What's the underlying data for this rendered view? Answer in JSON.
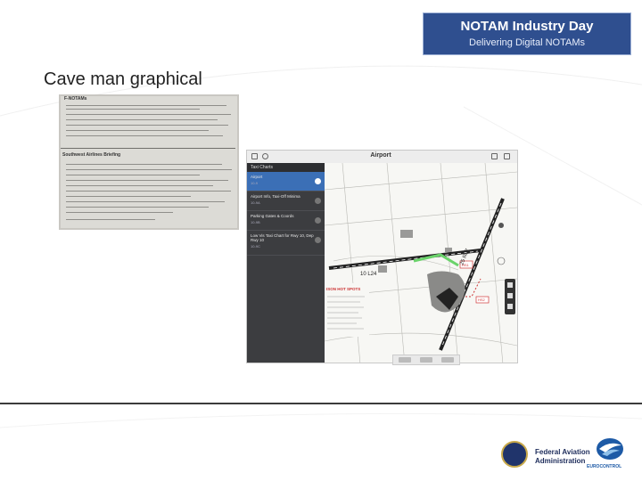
{
  "banner": {
    "line1": "NOTAM Industry Day",
    "line2": "Delivering Digital NOTAMs"
  },
  "slide": {
    "title": "Cave man graphical"
  },
  "paper_photo": {
    "header": "F-NOTAMs",
    "section": "Southwest Airlines Briefing"
  },
  "ipad": {
    "title": "Airport",
    "list_header": "Taxi Charts",
    "items": [
      {
        "label": "Airport",
        "sub": "10-9"
      },
      {
        "label": "Airport Info, Taxi-Off Minima",
        "sub": "10-9A"
      },
      {
        "label": "Parking Gates & Coords",
        "sub": "10-9B"
      },
      {
        "label": "Low Vis Taxi Chart for Rwy 10, Dep Rwy 10",
        "sub": "10-9C"
      }
    ],
    "map_labels": {
      "runway1": "10 L24",
      "runway2": "25 R07",
      "hotspots": "ISON HOT SPOTS",
      "hs1": "HS1",
      "hs2": "HS2"
    }
  },
  "footer": {
    "faa_line1": "Federal Aviation",
    "faa_line2": "Administration",
    "eurocontrol": "EUROCONTROL"
  },
  "colors": {
    "banner_bg": "#2f4f8f",
    "sidebar_bg": "#3c3d40",
    "selected": "#3b6fb6",
    "taxi_green": "#6bd36b",
    "hotspot_red": "#d13a3a"
  }
}
